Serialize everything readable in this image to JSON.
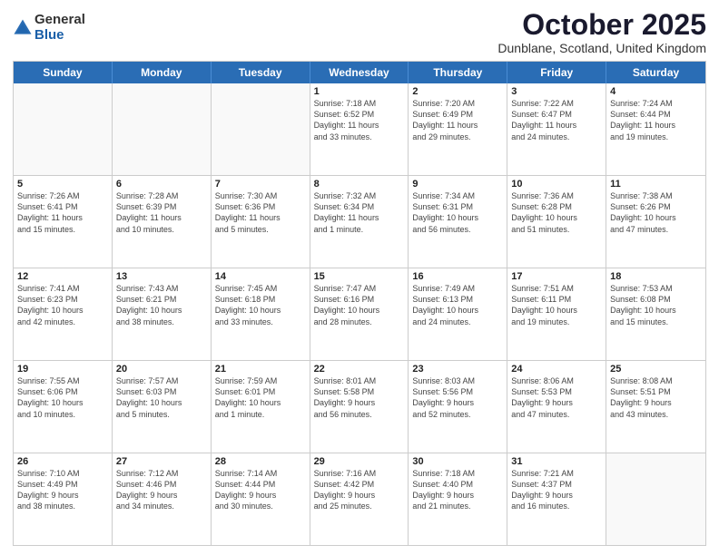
{
  "logo": {
    "general": "General",
    "blue": "Blue"
  },
  "title": "October 2025",
  "location": "Dunblane, Scotland, United Kingdom",
  "header_days": [
    "Sunday",
    "Monday",
    "Tuesday",
    "Wednesday",
    "Thursday",
    "Friday",
    "Saturday"
  ],
  "rows": [
    [
      {
        "day": "",
        "info": "",
        "empty": true
      },
      {
        "day": "",
        "info": "",
        "empty": true
      },
      {
        "day": "",
        "info": "",
        "empty": true
      },
      {
        "day": "1",
        "info": "Sunrise: 7:18 AM\nSunset: 6:52 PM\nDaylight: 11 hours\nand 33 minutes.",
        "empty": false
      },
      {
        "day": "2",
        "info": "Sunrise: 7:20 AM\nSunset: 6:49 PM\nDaylight: 11 hours\nand 29 minutes.",
        "empty": false
      },
      {
        "day": "3",
        "info": "Sunrise: 7:22 AM\nSunset: 6:47 PM\nDaylight: 11 hours\nand 24 minutes.",
        "empty": false
      },
      {
        "day": "4",
        "info": "Sunrise: 7:24 AM\nSunset: 6:44 PM\nDaylight: 11 hours\nand 19 minutes.",
        "empty": false
      }
    ],
    [
      {
        "day": "5",
        "info": "Sunrise: 7:26 AM\nSunset: 6:41 PM\nDaylight: 11 hours\nand 15 minutes.",
        "empty": false
      },
      {
        "day": "6",
        "info": "Sunrise: 7:28 AM\nSunset: 6:39 PM\nDaylight: 11 hours\nand 10 minutes.",
        "empty": false
      },
      {
        "day": "7",
        "info": "Sunrise: 7:30 AM\nSunset: 6:36 PM\nDaylight: 11 hours\nand 5 minutes.",
        "empty": false
      },
      {
        "day": "8",
        "info": "Sunrise: 7:32 AM\nSunset: 6:34 PM\nDaylight: 11 hours\nand 1 minute.",
        "empty": false
      },
      {
        "day": "9",
        "info": "Sunrise: 7:34 AM\nSunset: 6:31 PM\nDaylight: 10 hours\nand 56 minutes.",
        "empty": false
      },
      {
        "day": "10",
        "info": "Sunrise: 7:36 AM\nSunset: 6:28 PM\nDaylight: 10 hours\nand 51 minutes.",
        "empty": false
      },
      {
        "day": "11",
        "info": "Sunrise: 7:38 AM\nSunset: 6:26 PM\nDaylight: 10 hours\nand 47 minutes.",
        "empty": false
      }
    ],
    [
      {
        "day": "12",
        "info": "Sunrise: 7:41 AM\nSunset: 6:23 PM\nDaylight: 10 hours\nand 42 minutes.",
        "empty": false
      },
      {
        "day": "13",
        "info": "Sunrise: 7:43 AM\nSunset: 6:21 PM\nDaylight: 10 hours\nand 38 minutes.",
        "empty": false
      },
      {
        "day": "14",
        "info": "Sunrise: 7:45 AM\nSunset: 6:18 PM\nDaylight: 10 hours\nand 33 minutes.",
        "empty": false
      },
      {
        "day": "15",
        "info": "Sunrise: 7:47 AM\nSunset: 6:16 PM\nDaylight: 10 hours\nand 28 minutes.",
        "empty": false
      },
      {
        "day": "16",
        "info": "Sunrise: 7:49 AM\nSunset: 6:13 PM\nDaylight: 10 hours\nand 24 minutes.",
        "empty": false
      },
      {
        "day": "17",
        "info": "Sunrise: 7:51 AM\nSunset: 6:11 PM\nDaylight: 10 hours\nand 19 minutes.",
        "empty": false
      },
      {
        "day": "18",
        "info": "Sunrise: 7:53 AM\nSunset: 6:08 PM\nDaylight: 10 hours\nand 15 minutes.",
        "empty": false
      }
    ],
    [
      {
        "day": "19",
        "info": "Sunrise: 7:55 AM\nSunset: 6:06 PM\nDaylight: 10 hours\nand 10 minutes.",
        "empty": false
      },
      {
        "day": "20",
        "info": "Sunrise: 7:57 AM\nSunset: 6:03 PM\nDaylight: 10 hours\nand 5 minutes.",
        "empty": false
      },
      {
        "day": "21",
        "info": "Sunrise: 7:59 AM\nSunset: 6:01 PM\nDaylight: 10 hours\nand 1 minute.",
        "empty": false
      },
      {
        "day": "22",
        "info": "Sunrise: 8:01 AM\nSunset: 5:58 PM\nDaylight: 9 hours\nand 56 minutes.",
        "empty": false
      },
      {
        "day": "23",
        "info": "Sunrise: 8:03 AM\nSunset: 5:56 PM\nDaylight: 9 hours\nand 52 minutes.",
        "empty": false
      },
      {
        "day": "24",
        "info": "Sunrise: 8:06 AM\nSunset: 5:53 PM\nDaylight: 9 hours\nand 47 minutes.",
        "empty": false
      },
      {
        "day": "25",
        "info": "Sunrise: 8:08 AM\nSunset: 5:51 PM\nDaylight: 9 hours\nand 43 minutes.",
        "empty": false
      }
    ],
    [
      {
        "day": "26",
        "info": "Sunrise: 7:10 AM\nSunset: 4:49 PM\nDaylight: 9 hours\nand 38 minutes.",
        "empty": false
      },
      {
        "day": "27",
        "info": "Sunrise: 7:12 AM\nSunset: 4:46 PM\nDaylight: 9 hours\nand 34 minutes.",
        "empty": false
      },
      {
        "day": "28",
        "info": "Sunrise: 7:14 AM\nSunset: 4:44 PM\nDaylight: 9 hours\nand 30 minutes.",
        "empty": false
      },
      {
        "day": "29",
        "info": "Sunrise: 7:16 AM\nSunset: 4:42 PM\nDaylight: 9 hours\nand 25 minutes.",
        "empty": false
      },
      {
        "day": "30",
        "info": "Sunrise: 7:18 AM\nSunset: 4:40 PM\nDaylight: 9 hours\nand 21 minutes.",
        "empty": false
      },
      {
        "day": "31",
        "info": "Sunrise: 7:21 AM\nSunset: 4:37 PM\nDaylight: 9 hours\nand 16 minutes.",
        "empty": false
      },
      {
        "day": "",
        "info": "",
        "empty": true
      }
    ]
  ]
}
